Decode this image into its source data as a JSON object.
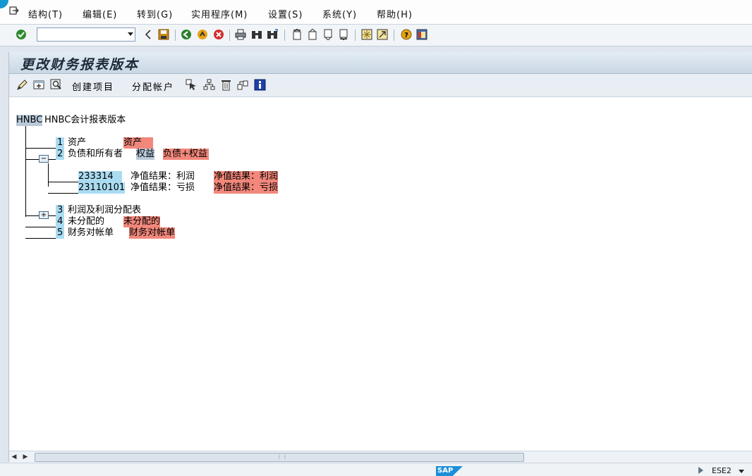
{
  "menu": {
    "items": [
      "结构(T)",
      "编辑(E)",
      "转到(G)",
      "实用程序(M)",
      "设置(S)",
      "系统(Y)",
      "帮助(H)"
    ]
  },
  "toolbar": {
    "command_value": "",
    "icons": [
      "enter-icon",
      "back-icon",
      "save-icon",
      "green-back-icon",
      "exit-icon",
      "cancel-icon",
      "print-icon",
      "find-icon",
      "find-next-icon",
      "first-page-icon",
      "prev-page-icon",
      "next-page-icon",
      "last-page-icon",
      "new-session-icon",
      "shortcut-icon",
      "help-icon",
      "layout-icon"
    ]
  },
  "screen": {
    "title": "更改财务报表版本"
  },
  "app_toolbar": {
    "create_item": "创建项目",
    "assign_accounts": "分配帐户",
    "icons": [
      "display-change-icon",
      "new-item-icon",
      "search-icon",
      "select-icon",
      "hierarchy-icon",
      "delete-icon",
      "reassign-icon",
      "info-icon"
    ]
  },
  "tree": {
    "root": {
      "key": "HNBC",
      "text": "HNBC会计报表版本"
    },
    "items": [
      {
        "no": "1",
        "text": "资产",
        "label": "资产"
      },
      {
        "no": "2",
        "text_a": "负债和所有者",
        "text_b": "权益",
        "label": "负债+权益"
      },
      {
        "no": "3",
        "text": "利润及利润分配表"
      },
      {
        "no": "4",
        "text": "未分配的",
        "label": "未分配的"
      },
      {
        "no": "5",
        "text": "财务对帐单",
        "label": "财务对帐单"
      }
    ],
    "children": [
      {
        "key": "233314",
        "text": "净值结果：利润",
        "label": "净值结果：利润"
      },
      {
        "key": "23110101",
        "text": "净值结果：亏损",
        "label": "净值结果：亏损"
      }
    ]
  },
  "status": {
    "brand": "SAP",
    "system": "ESE2"
  }
}
